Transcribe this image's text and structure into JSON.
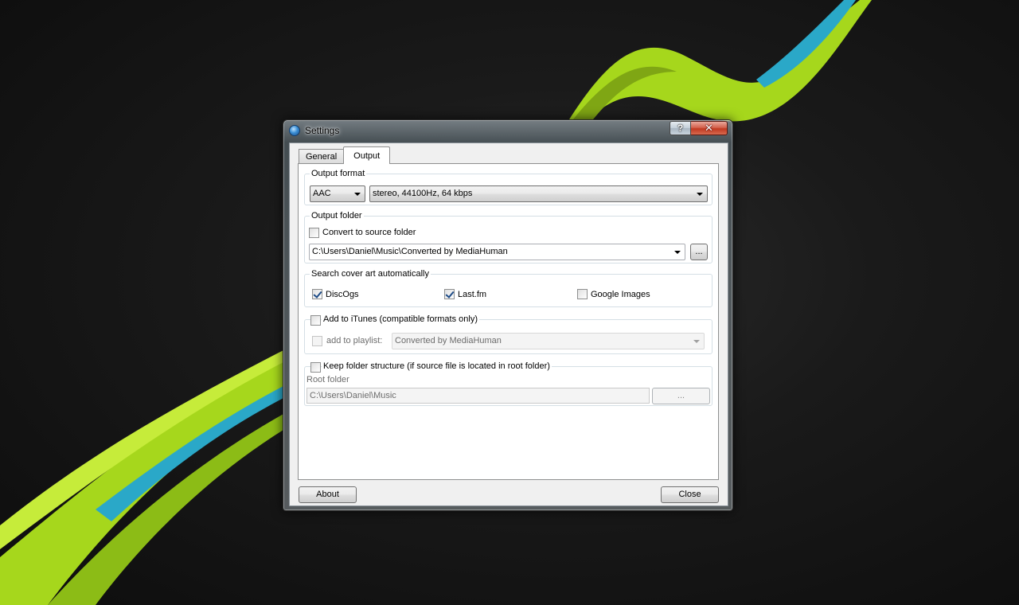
{
  "window": {
    "title": "Settings",
    "help_label": "?",
    "close_label": "✕"
  },
  "tabs": [
    {
      "label": "General",
      "active": false
    },
    {
      "label": "Output",
      "active": true
    }
  ],
  "output_format": {
    "title": "Output format",
    "format_value": "AAC",
    "quality_value": "stereo, 44100Hz, 64 kbps"
  },
  "output_folder": {
    "title": "Output folder",
    "convert_to_source_label": "Convert to source folder",
    "convert_to_source_checked": false,
    "path_value": "C:\\Users\\Daniel\\Music\\Converted by MediaHuman",
    "browse_label": "..."
  },
  "cover_art": {
    "title": "Search cover art automatically",
    "sources": [
      {
        "label": "DiscOgs",
        "checked": true
      },
      {
        "label": "Last.fm",
        "checked": true
      },
      {
        "label": "Google Images",
        "checked": false
      }
    ]
  },
  "itunes": {
    "label": "Add to iTunes (compatible formats only)",
    "checked": false,
    "playlist_label": "add to playlist:",
    "playlist_checked": false,
    "playlist_value": "Converted by MediaHuman"
  },
  "folder_structure": {
    "label": "Keep folder structure (if source file is located in root folder)",
    "checked": false,
    "root_folder_label": "Root folder",
    "root_folder_value": "C:\\Users\\Daniel\\Music",
    "browse_label": "..."
  },
  "footer": {
    "about_label": "About",
    "close_label": "Close"
  },
  "colors": {
    "wallpaper_bg": "#141414",
    "accent_green": "#a6d71c",
    "accent_cyan": "#2aa8c8",
    "close_button": "#c13a22"
  }
}
